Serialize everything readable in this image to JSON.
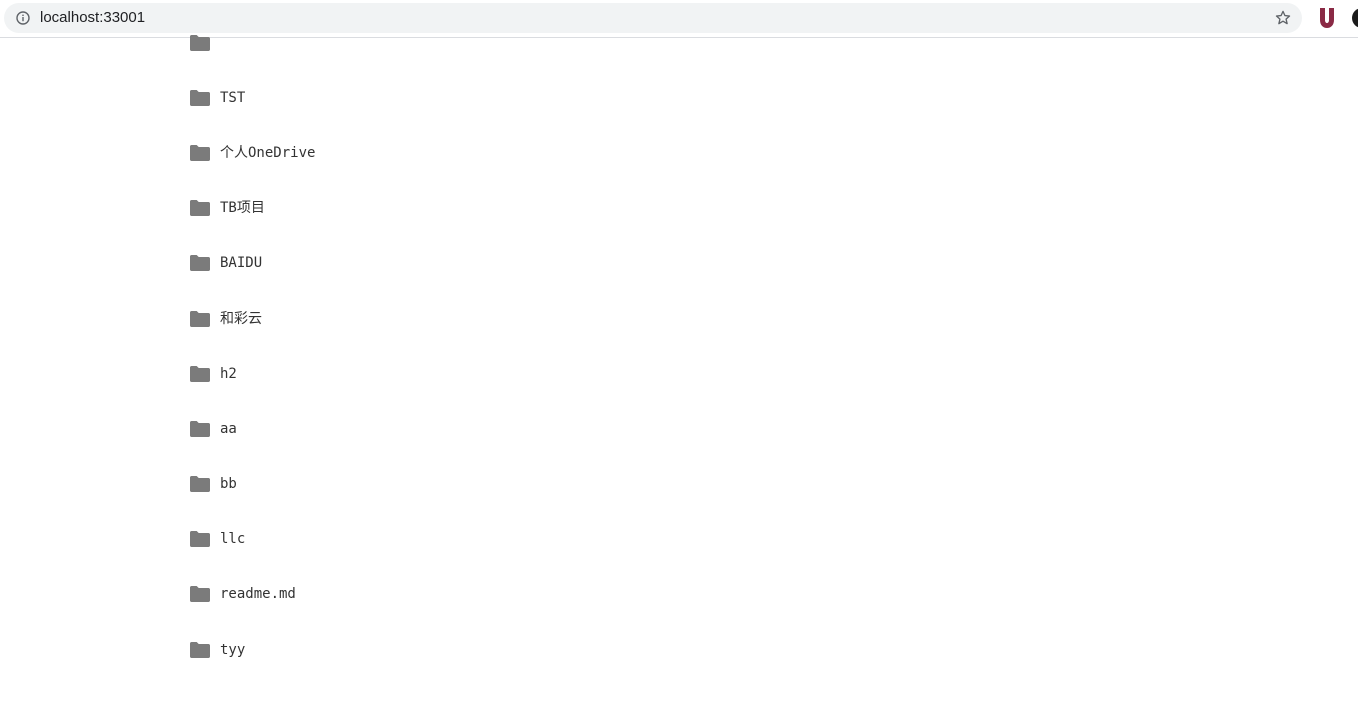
{
  "browser": {
    "url": "localhost:33001",
    "icons": {
      "info": "info-icon",
      "bookmark": "star-icon",
      "extension": "u-extension-icon"
    },
    "extension_label": "U",
    "extension_color": "#8a2a45"
  },
  "file_list": {
    "items": [
      {
        "name": "",
        "icon": "folder-icon"
      },
      {
        "name": "TST",
        "icon": "folder-icon"
      },
      {
        "name": "个人OneDrive",
        "icon": "folder-icon"
      },
      {
        "name": "TB项目",
        "icon": "folder-icon"
      },
      {
        "name": "BAIDU",
        "icon": "folder-icon"
      },
      {
        "name": "和彩云",
        "icon": "folder-icon"
      },
      {
        "name": "h2",
        "icon": "folder-icon"
      },
      {
        "name": "aa",
        "icon": "folder-icon"
      },
      {
        "name": "bb",
        "icon": "folder-icon"
      },
      {
        "name": "llc",
        "icon": "folder-icon"
      },
      {
        "name": "readme.md",
        "icon": "folder-icon"
      },
      {
        "name": "tyy",
        "icon": "folder-icon"
      }
    ]
  },
  "colors": {
    "folder": "#7b7b7b",
    "text": "#333333"
  }
}
